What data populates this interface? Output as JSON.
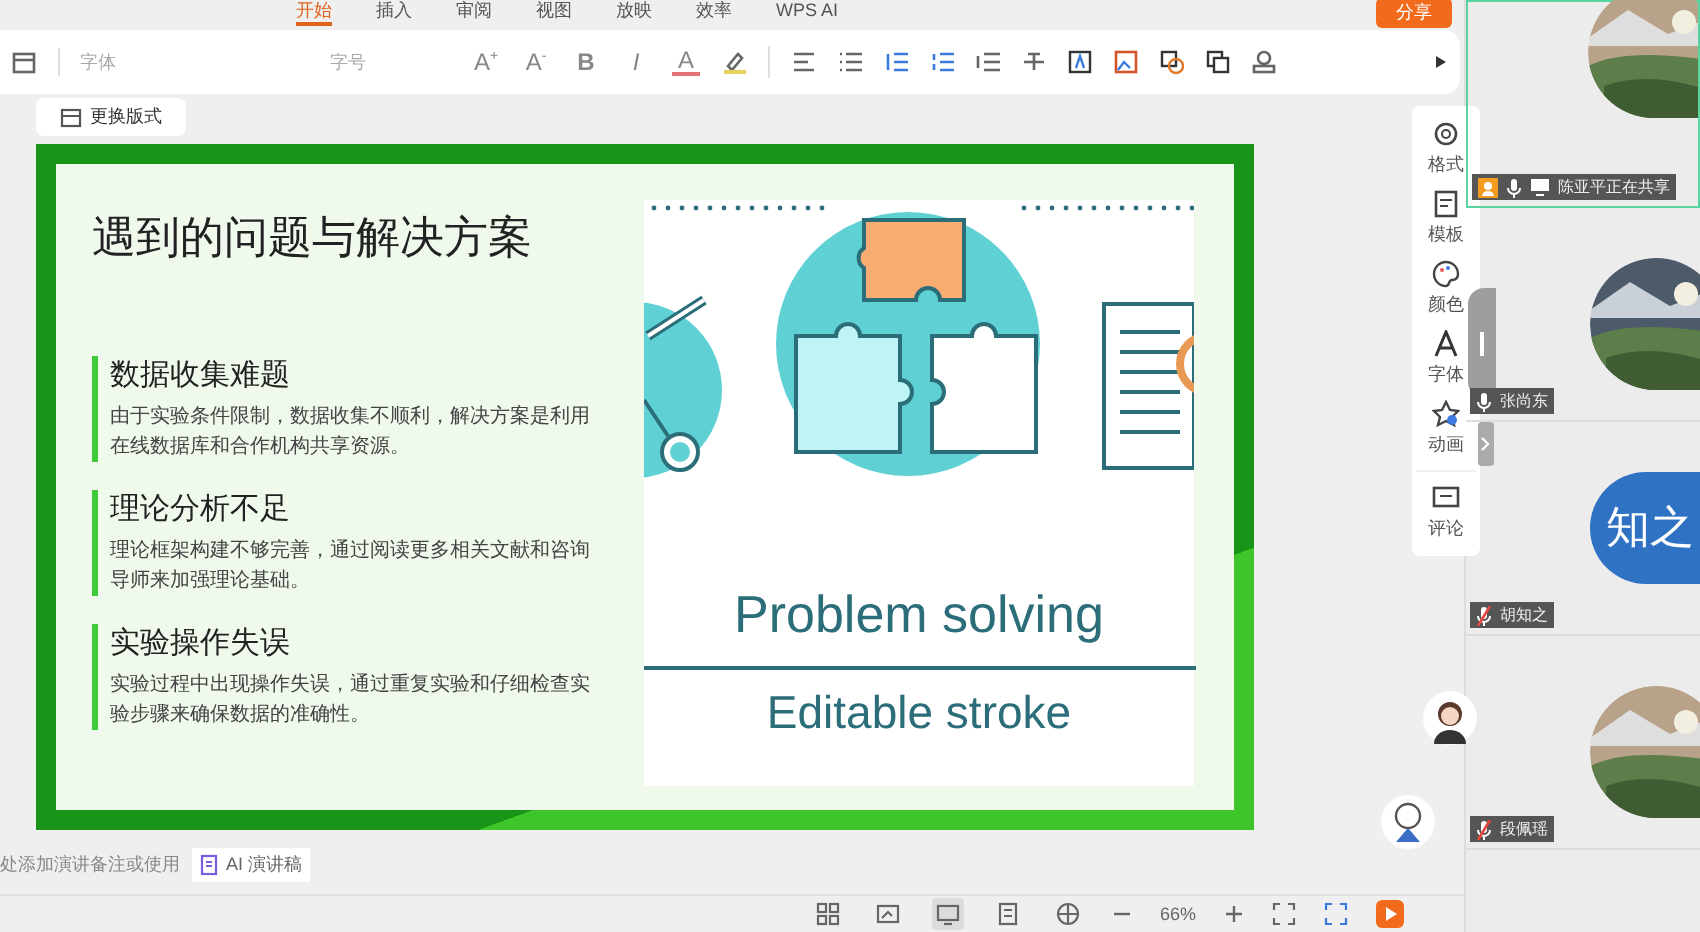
{
  "menu_tabs": [
    {
      "label": "开始",
      "selected": true
    },
    {
      "label": "插入",
      "selected": false
    },
    {
      "label": "审阅",
      "selected": false
    },
    {
      "label": "视图",
      "selected": false
    },
    {
      "label": "放映",
      "selected": false
    },
    {
      "label": "效率",
      "selected": false
    },
    {
      "label": "WPS AI",
      "selected": false
    }
  ],
  "share_button": "分享",
  "toolbar": {
    "font_placeholder": "字体",
    "size_placeholder": "字号",
    "format_buttons": [
      "A$^{+}$",
      "A$^{-}$",
      "B",
      "I",
      "A"
    ]
  },
  "layout_button": "更换版式",
  "slide": {
    "title": "遇到的问题与解决方案",
    "points": [
      {
        "heading": "数据收集难题",
        "body": "由于实验条件限制，数据收集不顺利，解决方案是利用在线数据库和合作机构共享资源。"
      },
      {
        "heading": "理论分析不足",
        "body": "理论框架构建不够完善，通过阅读更多相关文献和咨询导师来加强理论基础。"
      },
      {
        "heading": "实验操作失误",
        "body": "实验过程中出现操作失误，通过重复实验和仔细检查实验步骤来确保数据的准确性。"
      }
    ],
    "image_caption": "Problem solving",
    "image_subcaption": "Editable stroke"
  },
  "side_tools": [
    {
      "kind": "format",
      "label": "格式"
    },
    {
      "kind": "template",
      "label": "模板"
    },
    {
      "kind": "color",
      "label": "颜色"
    },
    {
      "kind": "font",
      "label": "字体"
    },
    {
      "kind": "animation",
      "label": "动画"
    },
    {
      "kind": "comment",
      "label": "评论"
    }
  ],
  "notes_placeholder": "处添加演讲备注或使用",
  "ai_button": "AI 演讲稿",
  "status_bar": {
    "views": [
      {
        "kind": "grid",
        "selected": false
      },
      {
        "kind": "sorter",
        "selected": false
      },
      {
        "kind": "normal",
        "selected": true
      },
      {
        "kind": "notes",
        "selected": false
      },
      {
        "kind": "web",
        "selected": false
      }
    ],
    "zoom": "66%"
  },
  "participants": [
    {
      "name": "陈亚平正在共享",
      "kind": "picture",
      "sharing": true,
      "muted": false
    },
    {
      "name": "张尚东",
      "kind": "picture",
      "sharing": false,
      "muted": false
    },
    {
      "name": "胡知之",
      "kind": "text",
      "avatar_text": "知之",
      "sharing": false,
      "muted": true
    },
    {
      "name": "段佩瑶",
      "kind": "picture",
      "sharing": false,
      "muted": true
    }
  ]
}
